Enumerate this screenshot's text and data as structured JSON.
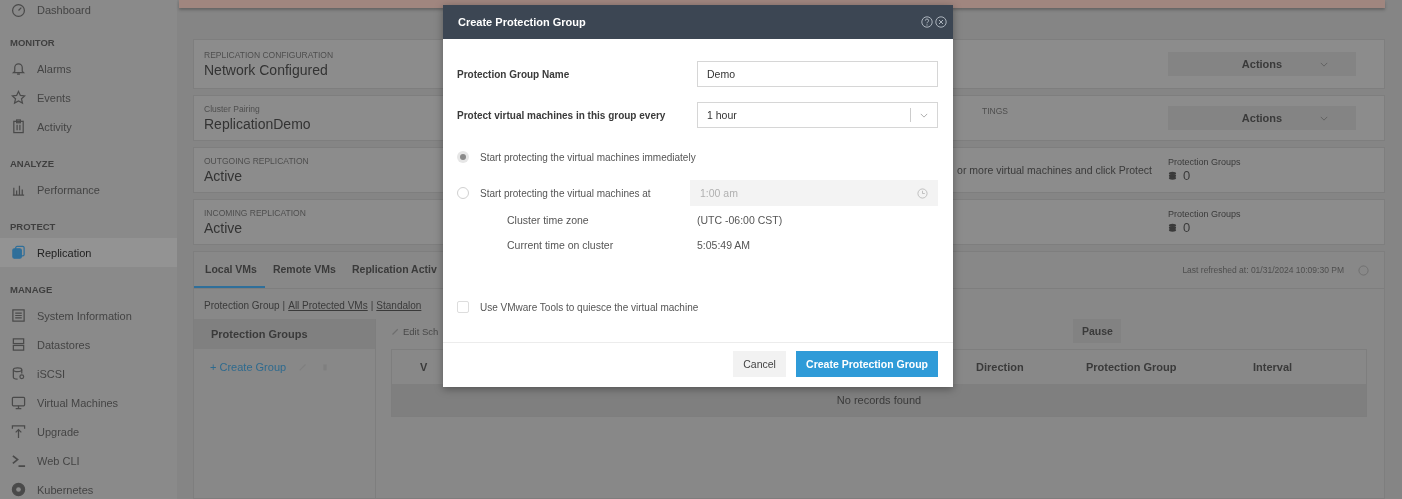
{
  "sidebar": {
    "items": [
      {
        "kind": "item",
        "label": "Dashboard",
        "selected": false
      },
      {
        "kind": "section",
        "label": "MONITOR"
      },
      {
        "kind": "item",
        "label": "Alarms",
        "selected": false
      },
      {
        "kind": "item",
        "label": "Events",
        "selected": false
      },
      {
        "kind": "item",
        "label": "Activity",
        "selected": false
      },
      {
        "kind": "section",
        "label": "ANALYZE"
      },
      {
        "kind": "item",
        "label": "Performance",
        "selected": false
      },
      {
        "kind": "section",
        "label": "PROTECT"
      },
      {
        "kind": "item",
        "label": "Replication",
        "selected": true
      },
      {
        "kind": "section",
        "label": "MANAGE"
      },
      {
        "kind": "item",
        "label": "System Information",
        "selected": false
      },
      {
        "kind": "item",
        "label": "Datastores",
        "selected": false
      },
      {
        "kind": "item",
        "label": "iSCSI",
        "selected": false
      },
      {
        "kind": "item",
        "label": "Virtual Machines",
        "selected": false
      },
      {
        "kind": "item",
        "label": "Upgrade",
        "selected": false
      },
      {
        "kind": "item",
        "label": "Web CLI",
        "selected": false
      },
      {
        "kind": "item",
        "label": "Kubernetes",
        "selected": false
      }
    ]
  },
  "cards": [
    {
      "kind": "action",
      "caption": "REPLICATION CONFIGURATION",
      "value": "Network Configured",
      "action": "Actions"
    },
    {
      "kind": "action",
      "caption": "Cluster Pairing",
      "value": "ReplicationDemo",
      "fragment": "TINGS",
      "action": "Actions"
    },
    {
      "kind": "stat",
      "caption": "OUTGOING REPLICATION",
      "value": "Active",
      "fragment": "or more virtual machines and click Protect",
      "stat_label": "Protection Groups",
      "stat_value": "0"
    },
    {
      "kind": "stat",
      "caption": "INCOMING REPLICATION",
      "value": "Active",
      "stat_label": "Protection Groups",
      "stat_value": "0"
    }
  ],
  "tabs": [
    {
      "label": "Local VMs",
      "selected": true
    },
    {
      "label": "Remote VMs",
      "selected": false
    },
    {
      "label": "Replication Activ",
      "selected": false
    }
  ],
  "last_refreshed": "Last refreshed at: 01/31/2024 10:09:30 PM",
  "filter": [
    {
      "kind": "text",
      "label": "Protection Group"
    },
    {
      "kind": "separator",
      "label": "|"
    },
    {
      "kind": "link",
      "label": "All Protected VMs"
    },
    {
      "kind": "separator",
      "label": "|"
    },
    {
      "kind": "link",
      "label": "Standalon"
    }
  ],
  "groups_panel": {
    "title": "Protection Groups",
    "create": "+ Create Group"
  },
  "toolbar": {
    "edit": "Edit Sch",
    "pause": "Pause"
  },
  "table": {
    "columns": [
      "V",
      "Direction",
      "Protection Group",
      "Interval"
    ],
    "empty": "No records found"
  },
  "dialog": {
    "title": "Create Protection Group",
    "name_label": "Protection Group Name",
    "name_value": "Demo",
    "interval_label": "Protect virtual machines in this group every",
    "interval_value": "1 hour",
    "start_options": [
      {
        "label": "Start protecting the virtual machines immediately",
        "selected": true
      },
      {
        "label": "Start protecting the virtual machines at",
        "selected": false
      }
    ],
    "time_field": {
      "value": "1:00 am",
      "disabled": true
    },
    "info": [
      {
        "label": "Cluster time zone",
        "value": "(UTC -06:00 CST)"
      },
      {
        "label": "Current time on cluster",
        "value": "5:05:49 AM"
      }
    ],
    "quiesce": {
      "label": "Use VMware Tools to quiesce the virtual machine",
      "checked": false
    },
    "buttons": [
      {
        "label": "Cancel",
        "kind": "secondary"
      },
      {
        "label": "Create Protection Group",
        "kind": "primary"
      }
    ]
  }
}
